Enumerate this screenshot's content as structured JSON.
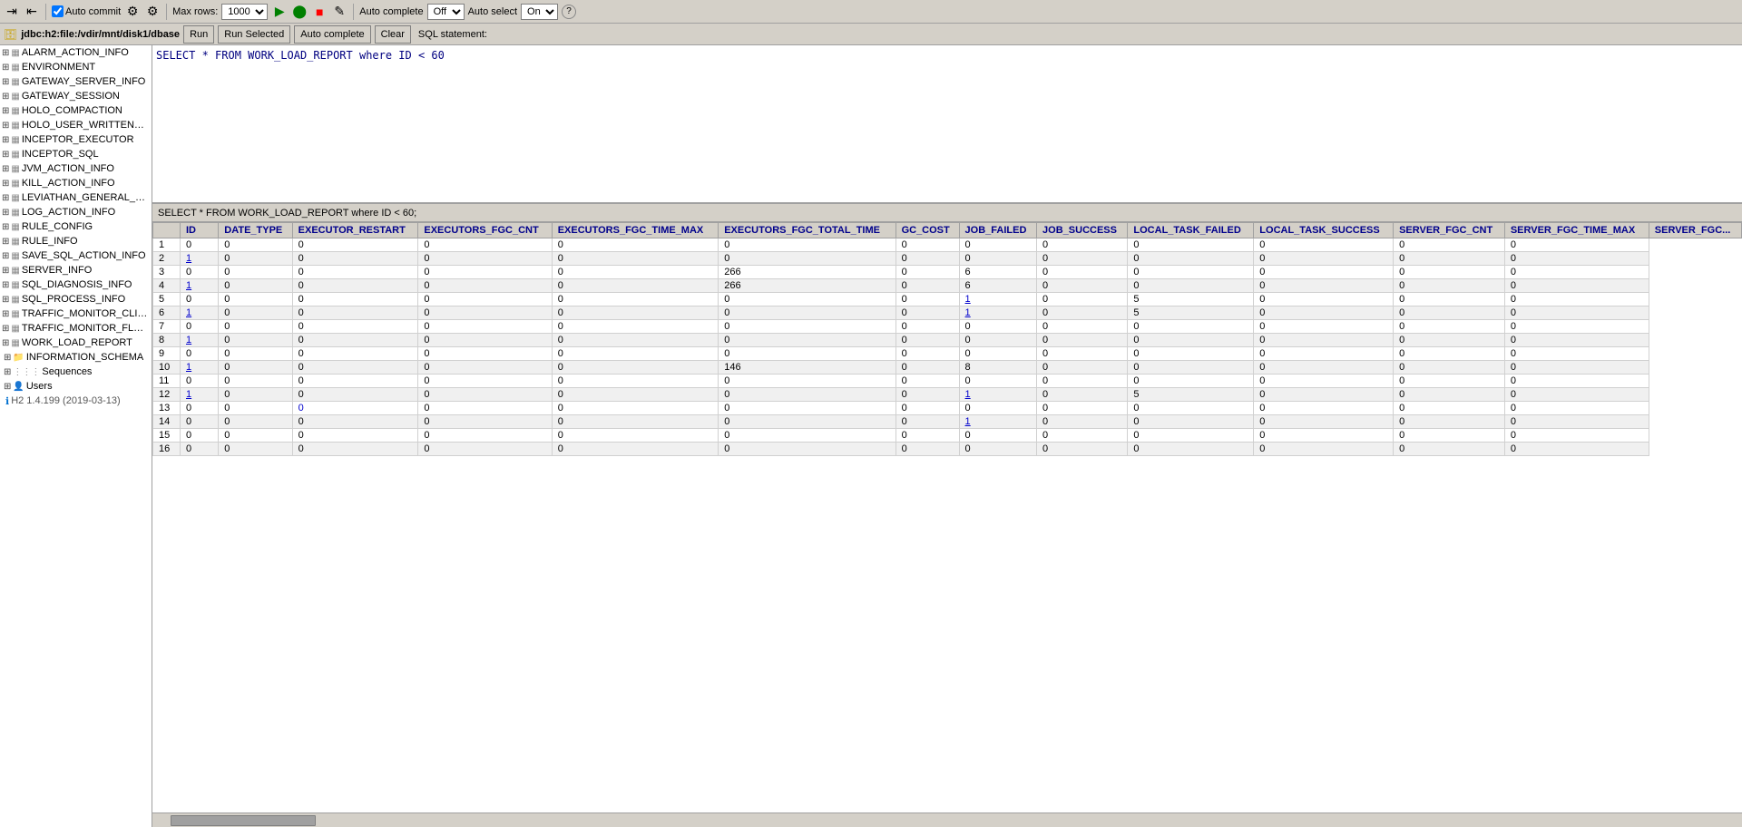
{
  "toolbar": {
    "auto_commit_label": "Auto commit",
    "max_rows_label": "Max rows:",
    "max_rows_value": "1000",
    "auto_complete_label": "Auto complete",
    "auto_complete_value": "Off",
    "auto_select_label": "Auto select",
    "auto_select_value": "On"
  },
  "connection": {
    "label": "jdbc:h2:file:/vdir/mnt/disk1/dbase",
    "buttons": [
      "Run",
      "Run Selected",
      "Auto complete",
      "Clear",
      "SQL statement:"
    ]
  },
  "sql_query": "SELECT * FROM WORK_LOAD_REPORT where ID < 60",
  "sql_display": "SELECT * FROM WORK_LOAD_REPORT where ID < 60;",
  "sidebar": {
    "tables": [
      "ALARM_ACTION_INFO",
      "ENVIRONMENT",
      "GATEWAY_SERVER_INFO",
      "GATEWAY_SESSION",
      "HOLO_COMPACTION",
      "HOLO_USER_WRITTEN_ST...",
      "INCEPTOR_EXECUTOR",
      "INCEPTOR_SQL",
      "JVM_ACTION_INFO",
      "KILL_ACTION_INFO",
      "LEVIATHAN_GENERAL_STO...",
      "LOG_ACTION_INFO",
      "RULE_CONFIG",
      "RULE_INFO",
      "SAVE_SQL_ACTION_INFO",
      "SERVER_INFO",
      "SQL_DIAGNOSIS_INFO",
      "SQL_PROCESS_INFO",
      "TRAFFIC_MONITOR_CLIEN...",
      "TRAFFIC_MONITOR_FLUSH...",
      "WORK_LOAD_REPORT"
    ],
    "folders": [
      "INFORMATION_SCHEMA",
      "Sequences",
      "Users"
    ],
    "version": "H2 1.4.199 (2019-03-13)"
  },
  "columns": [
    "ID",
    "DATE_TYPE",
    "EXECUTOR_RESTART",
    "EXECUTORS_FGC_CNT",
    "EXECUTORS_FGC_TIME_MAX",
    "EXECUTORS_FGC_TOTAL_TIME",
    "GC_COST",
    "JOB_FAILED",
    "JOB_SUCCESS",
    "LOCAL_TASK_FAILED",
    "LOCAL_TASK_SUCCESS",
    "SERVER_FGC_CNT",
    "SERVER_FGC_TIME_MAX",
    "SERVER_FGC..."
  ],
  "rows": [
    [
      1,
      "0",
      "0",
      "0",
      "0",
      "0",
      "0",
      "0",
      "0",
      "0",
      "0",
      "0",
      "0",
      "0"
    ],
    [
      2,
      "1",
      "0",
      "0",
      "0",
      "0",
      "0",
      "0",
      "0",
      "0",
      "0",
      "0",
      "0",
      "0"
    ],
    [
      3,
      "0",
      "0",
      "0",
      "0",
      "0",
      "266",
      "0",
      "6",
      "0",
      "0",
      "0",
      "0",
      "0"
    ],
    [
      4,
      "1",
      "0",
      "0",
      "0",
      "0",
      "266",
      "0",
      "6",
      "0",
      "0",
      "0",
      "0",
      "0"
    ],
    [
      5,
      "0",
      "0",
      "0",
      "0",
      "0",
      "0",
      "0",
      "1",
      "0",
      "5",
      "0",
      "0",
      "0"
    ],
    [
      6,
      "1",
      "0",
      "0",
      "0",
      "0",
      "0",
      "0",
      "1",
      "0",
      "5",
      "0",
      "0",
      "0"
    ],
    [
      7,
      "0",
      "0",
      "0",
      "0",
      "0",
      "0",
      "0",
      "0",
      "0",
      "0",
      "0",
      "0",
      "0"
    ],
    [
      8,
      "1",
      "0",
      "0",
      "0",
      "0",
      "0",
      "0",
      "0",
      "0",
      "0",
      "0",
      "0",
      "0"
    ],
    [
      9,
      "0",
      "0",
      "0",
      "0",
      "0",
      "0",
      "0",
      "0",
      "0",
      "0",
      "0",
      "0",
      "0"
    ],
    [
      10,
      "1",
      "0",
      "0",
      "0",
      "0",
      "146",
      "0",
      "8",
      "0",
      "0",
      "0",
      "0",
      "0"
    ],
    [
      11,
      "0",
      "0",
      "0",
      "0",
      "0",
      "0",
      "0",
      "0",
      "0",
      "0",
      "0",
      "0",
      "0"
    ],
    [
      12,
      "1",
      "0",
      "0",
      "0",
      "0",
      "0",
      "0",
      "1",
      "0",
      "5",
      "0",
      "0",
      "0"
    ],
    [
      13,
      "0",
      "0",
      "0",
      "0",
      "0",
      "0",
      "0",
      "0",
      "0",
      "0",
      "0",
      "0",
      "0"
    ],
    [
      14,
      "0",
      "0",
      "0",
      "0",
      "0",
      "0",
      "0",
      "1",
      "0",
      "0",
      "0",
      "0",
      "0"
    ],
    [
      15,
      "0",
      "0",
      "0",
      "0",
      "0",
      "0",
      "0",
      "0",
      "0",
      "0",
      "0",
      "0",
      "0"
    ],
    [
      16,
      "0",
      "0",
      "0",
      "0",
      "0",
      "0",
      "0",
      "0",
      "0",
      "0",
      "0",
      "0",
      "0"
    ]
  ],
  "link_cells": {
    "2_1": true,
    "4_1": true,
    "5_8": true,
    "6_1": true,
    "6_8": true,
    "8_1": true,
    "10_1": true,
    "12_1": true,
    "12_8": true,
    "13_3": true,
    "14_8": true
  }
}
